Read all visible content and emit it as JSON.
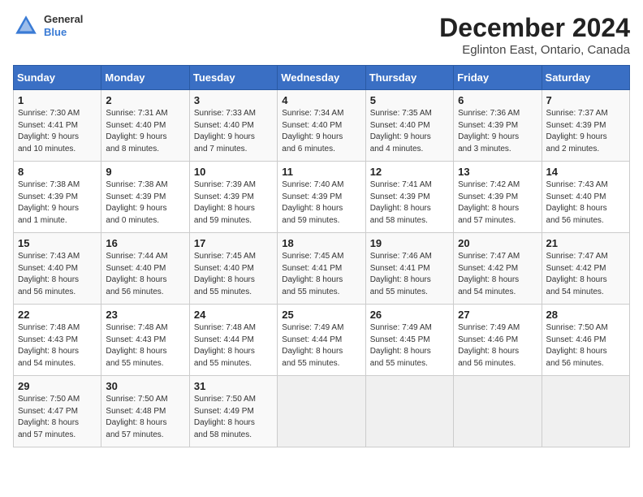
{
  "header": {
    "title": "December 2024",
    "subtitle": "Eglinton East, Ontario, Canada",
    "logo_line1": "General",
    "logo_line2": "Blue"
  },
  "days_of_week": [
    "Sunday",
    "Monday",
    "Tuesday",
    "Wednesday",
    "Thursday",
    "Friday",
    "Saturday"
  ],
  "weeks": [
    [
      {
        "day": "1",
        "info": "Sunrise: 7:30 AM\nSunset: 4:41 PM\nDaylight: 9 hours\nand 10 minutes."
      },
      {
        "day": "2",
        "info": "Sunrise: 7:31 AM\nSunset: 4:40 PM\nDaylight: 9 hours\nand 8 minutes."
      },
      {
        "day": "3",
        "info": "Sunrise: 7:33 AM\nSunset: 4:40 PM\nDaylight: 9 hours\nand 7 minutes."
      },
      {
        "day": "4",
        "info": "Sunrise: 7:34 AM\nSunset: 4:40 PM\nDaylight: 9 hours\nand 6 minutes."
      },
      {
        "day": "5",
        "info": "Sunrise: 7:35 AM\nSunset: 4:40 PM\nDaylight: 9 hours\nand 4 minutes."
      },
      {
        "day": "6",
        "info": "Sunrise: 7:36 AM\nSunset: 4:39 PM\nDaylight: 9 hours\nand 3 minutes."
      },
      {
        "day": "7",
        "info": "Sunrise: 7:37 AM\nSunset: 4:39 PM\nDaylight: 9 hours\nand 2 minutes."
      }
    ],
    [
      {
        "day": "8",
        "info": "Sunrise: 7:38 AM\nSunset: 4:39 PM\nDaylight: 9 hours\nand 1 minute."
      },
      {
        "day": "9",
        "info": "Sunrise: 7:38 AM\nSunset: 4:39 PM\nDaylight: 9 hours\nand 0 minutes."
      },
      {
        "day": "10",
        "info": "Sunrise: 7:39 AM\nSunset: 4:39 PM\nDaylight: 8 hours\nand 59 minutes."
      },
      {
        "day": "11",
        "info": "Sunrise: 7:40 AM\nSunset: 4:39 PM\nDaylight: 8 hours\nand 59 minutes."
      },
      {
        "day": "12",
        "info": "Sunrise: 7:41 AM\nSunset: 4:39 PM\nDaylight: 8 hours\nand 58 minutes."
      },
      {
        "day": "13",
        "info": "Sunrise: 7:42 AM\nSunset: 4:39 PM\nDaylight: 8 hours\nand 57 minutes."
      },
      {
        "day": "14",
        "info": "Sunrise: 7:43 AM\nSunset: 4:40 PM\nDaylight: 8 hours\nand 56 minutes."
      }
    ],
    [
      {
        "day": "15",
        "info": "Sunrise: 7:43 AM\nSunset: 4:40 PM\nDaylight: 8 hours\nand 56 minutes."
      },
      {
        "day": "16",
        "info": "Sunrise: 7:44 AM\nSunset: 4:40 PM\nDaylight: 8 hours\nand 56 minutes."
      },
      {
        "day": "17",
        "info": "Sunrise: 7:45 AM\nSunset: 4:40 PM\nDaylight: 8 hours\nand 55 minutes."
      },
      {
        "day": "18",
        "info": "Sunrise: 7:45 AM\nSunset: 4:41 PM\nDaylight: 8 hours\nand 55 minutes."
      },
      {
        "day": "19",
        "info": "Sunrise: 7:46 AM\nSunset: 4:41 PM\nDaylight: 8 hours\nand 55 minutes."
      },
      {
        "day": "20",
        "info": "Sunrise: 7:47 AM\nSunset: 4:42 PM\nDaylight: 8 hours\nand 54 minutes."
      },
      {
        "day": "21",
        "info": "Sunrise: 7:47 AM\nSunset: 4:42 PM\nDaylight: 8 hours\nand 54 minutes."
      }
    ],
    [
      {
        "day": "22",
        "info": "Sunrise: 7:48 AM\nSunset: 4:43 PM\nDaylight: 8 hours\nand 54 minutes."
      },
      {
        "day": "23",
        "info": "Sunrise: 7:48 AM\nSunset: 4:43 PM\nDaylight: 8 hours\nand 55 minutes."
      },
      {
        "day": "24",
        "info": "Sunrise: 7:48 AM\nSunset: 4:44 PM\nDaylight: 8 hours\nand 55 minutes."
      },
      {
        "day": "25",
        "info": "Sunrise: 7:49 AM\nSunset: 4:44 PM\nDaylight: 8 hours\nand 55 minutes."
      },
      {
        "day": "26",
        "info": "Sunrise: 7:49 AM\nSunset: 4:45 PM\nDaylight: 8 hours\nand 55 minutes."
      },
      {
        "day": "27",
        "info": "Sunrise: 7:49 AM\nSunset: 4:46 PM\nDaylight: 8 hours\nand 56 minutes."
      },
      {
        "day": "28",
        "info": "Sunrise: 7:50 AM\nSunset: 4:46 PM\nDaylight: 8 hours\nand 56 minutes."
      }
    ],
    [
      {
        "day": "29",
        "info": "Sunrise: 7:50 AM\nSunset: 4:47 PM\nDaylight: 8 hours\nand 57 minutes."
      },
      {
        "day": "30",
        "info": "Sunrise: 7:50 AM\nSunset: 4:48 PM\nDaylight: 8 hours\nand 57 minutes."
      },
      {
        "day": "31",
        "info": "Sunrise: 7:50 AM\nSunset: 4:49 PM\nDaylight: 8 hours\nand 58 minutes."
      },
      {
        "day": "",
        "info": ""
      },
      {
        "day": "",
        "info": ""
      },
      {
        "day": "",
        "info": ""
      },
      {
        "day": "",
        "info": ""
      }
    ]
  ]
}
